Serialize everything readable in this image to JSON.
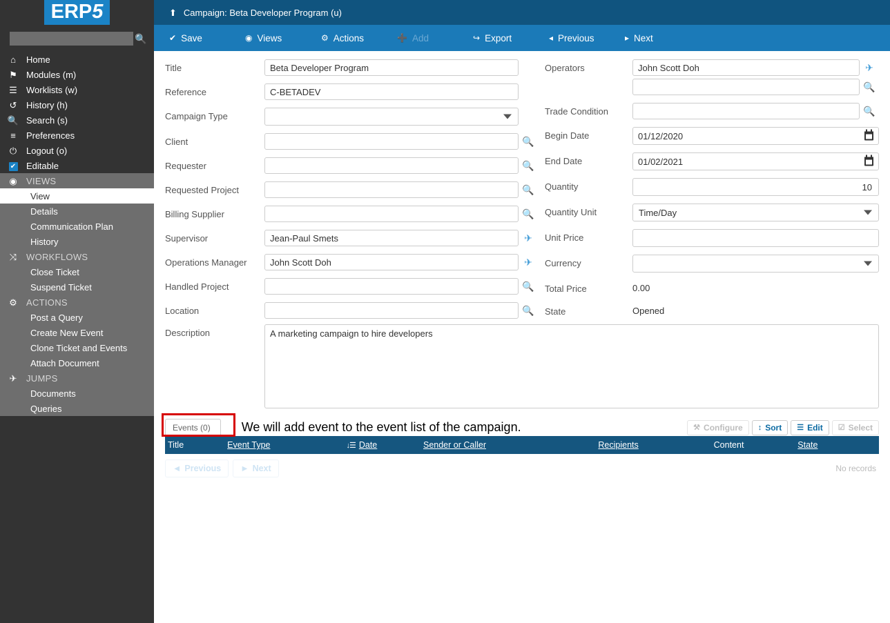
{
  "brand": {
    "logo_text": "ERP",
    "logo_accent": "5",
    "logo_color": "#1b83c6"
  },
  "sidebar": {
    "search": {
      "value": "",
      "placeholder": ""
    },
    "search_icon": "search-icon",
    "items": [
      {
        "label": "Home",
        "icon": "home-icon",
        "type": "link"
      },
      {
        "label": "Modules (m)",
        "icon": "modules-icon",
        "type": "link"
      },
      {
        "label": "Worklists (w)",
        "icon": "worklists-icon",
        "type": "link"
      },
      {
        "label": "History (h)",
        "icon": "history-icon",
        "type": "link"
      },
      {
        "label": "Search (s)",
        "icon": "search-icon",
        "type": "link"
      },
      {
        "label": "Preferences",
        "icon": "sliders-icon",
        "type": "link"
      },
      {
        "label": "Logout (o)",
        "icon": "power-icon",
        "type": "link"
      },
      {
        "label": "Editable",
        "icon": "checkbox-checked-icon",
        "type": "checkbox"
      },
      {
        "label": "VIEWS",
        "icon": "eye-icon",
        "type": "group"
      },
      {
        "label": "View",
        "icon": "",
        "type": "sub",
        "active": true
      },
      {
        "label": "Details",
        "icon": "",
        "type": "sub"
      },
      {
        "label": "Communication Plan",
        "icon": "",
        "type": "sub"
      },
      {
        "label": "History",
        "icon": "",
        "type": "sub"
      },
      {
        "label": "WORKFLOWS",
        "icon": "shuffle-icon",
        "type": "group"
      },
      {
        "label": "Close Ticket",
        "icon": "",
        "type": "sub"
      },
      {
        "label": "Suspend Ticket",
        "icon": "",
        "type": "sub"
      },
      {
        "label": "ACTIONS",
        "icon": "gear-icon",
        "type": "group"
      },
      {
        "label": "Post a Query",
        "icon": "",
        "type": "sub"
      },
      {
        "label": "Create New Event",
        "icon": "",
        "type": "sub"
      },
      {
        "label": "Clone Ticket and Events",
        "icon": "",
        "type": "sub"
      },
      {
        "label": "Attach Document",
        "icon": "",
        "type": "sub"
      },
      {
        "label": "JUMPS",
        "icon": "plane-icon",
        "type": "group"
      },
      {
        "label": "Documents",
        "icon": "",
        "type": "sub"
      },
      {
        "label": "Queries",
        "icon": "",
        "type": "sub"
      }
    ]
  },
  "header": {
    "title": "Campaign: Beta Developer Program (u)",
    "up_icon": "up-arrow-icon",
    "bg": "#10547f"
  },
  "toolbar": {
    "bg": "#1b7ab8",
    "buttons": [
      {
        "label": "Save",
        "icon": "check-icon",
        "disabled": false
      },
      {
        "label": "Views",
        "icon": "eye-icon",
        "disabled": false
      },
      {
        "label": "Actions",
        "icon": "gear-icon",
        "disabled": false
      },
      {
        "label": "Add",
        "icon": "plus-icon",
        "disabled": true
      },
      {
        "label": "Export",
        "icon": "export-icon",
        "disabled": false
      },
      {
        "label": "Previous",
        "icon": "left-arrow-icon",
        "disabled": false
      },
      {
        "label": "Next",
        "icon": "right-arrow-icon",
        "disabled": false
      }
    ]
  },
  "form": {
    "left": {
      "title": {
        "label": "Title",
        "value": "Beta Developer Program"
      },
      "reference": {
        "label": "Reference",
        "value": "C-BETADEV"
      },
      "campaign_type": {
        "label": "Campaign Type",
        "value": ""
      },
      "client": {
        "label": "Client",
        "value": ""
      },
      "requester": {
        "label": "Requester",
        "value": ""
      },
      "requested_project": {
        "label": "Requested Project",
        "value": ""
      },
      "billing_supplier": {
        "label": "Billing Supplier",
        "value": ""
      },
      "supervisor": {
        "label": "Supervisor",
        "value": "Jean-Paul Smets"
      },
      "operations_manager": {
        "label": "Operations Manager",
        "value": "John Scott Doh"
      },
      "handled_project": {
        "label": "Handled Project",
        "value": ""
      },
      "location": {
        "label": "Location",
        "value": ""
      },
      "description": {
        "label": "Description",
        "value": "A marketing campaign to hire developers"
      }
    },
    "right": {
      "operators": {
        "label": "Operators",
        "value": "John Scott Doh",
        "value2": ""
      },
      "trade_condition": {
        "label": "Trade Condition",
        "value": ""
      },
      "begin_date": {
        "label": "Begin Date",
        "value": "01/12/2020"
      },
      "end_date": {
        "label": "End Date",
        "value": "01/02/2021"
      },
      "quantity": {
        "label": "Quantity",
        "value": "10"
      },
      "quantity_unit": {
        "label": "Quantity Unit",
        "value": "Time/Day"
      },
      "unit_price": {
        "label": "Unit Price",
        "value": ""
      },
      "currency": {
        "label": "Currency",
        "value": ""
      },
      "total_price": {
        "label": "Total Price",
        "value": "0.00"
      },
      "state": {
        "label": "State",
        "value": "Opened"
      }
    }
  },
  "annotation": {
    "text": "We will add event to the event list of the campaign.",
    "highlight_color": "#d60000"
  },
  "listbox": {
    "tab_label": "Events (0)",
    "tools": [
      {
        "label": "Configure",
        "icon": "wrench-icon",
        "disabled": true
      },
      {
        "label": "Sort",
        "icon": "sort-icon",
        "disabled": false
      },
      {
        "label": "Edit",
        "icon": "list-icon",
        "disabled": false
      },
      {
        "label": "Select",
        "icon": "checkbox-icon",
        "disabled": true
      }
    ],
    "columns": [
      {
        "label": "Title",
        "sorted": false,
        "link": false
      },
      {
        "label": "Event Type",
        "sorted": false,
        "link": true
      },
      {
        "label": "Date",
        "sorted": true,
        "link": true
      },
      {
        "label": "Sender or Caller",
        "sorted": false,
        "link": true
      },
      {
        "label": "Recipients",
        "sorted": false,
        "link": true
      },
      {
        "label": "Content",
        "sorted": false,
        "link": false
      },
      {
        "label": "State",
        "sorted": false,
        "link": true
      }
    ],
    "rows": [],
    "pagination": {
      "previous": "Previous",
      "next": "Next"
    },
    "no_records": "No records"
  }
}
